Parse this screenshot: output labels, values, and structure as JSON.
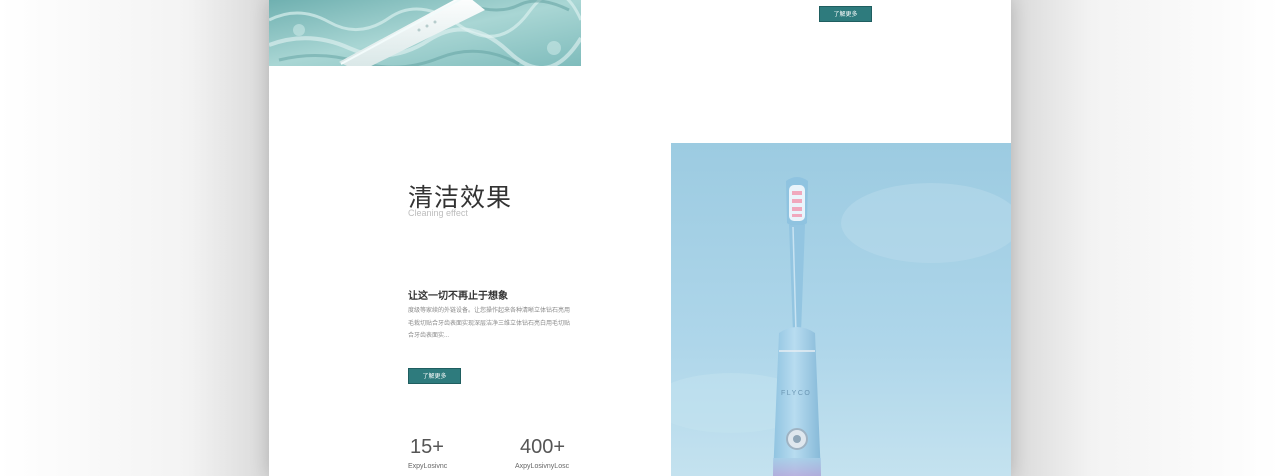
{
  "top_section": {
    "image_icon": "toothbrush-in-water-photo",
    "button_label": "了解更多"
  },
  "cleaning_section": {
    "title": "清洁效果",
    "subtitle_en": "Cleaning effect",
    "heading": "让这一切不再止于想象",
    "description": "度级等家续的外链设备。让您操作起来各种清晰立体钻石亮用毛栽切贴合牙齿表面实现深层洁净三维立体钻石亮白用毛切贴合牙齿表面实...",
    "button_label": "了解更多",
    "stats": [
      {
        "value": "15+",
        "label": "ExpyLosivnc"
      },
      {
        "value": "400+",
        "label": "AxpyLosivnyLosc"
      }
    ],
    "product_image_icon": "electric-toothbrush-photo",
    "brand_text": "FLYCO"
  },
  "colors": {
    "accent": "#2e7b7d",
    "sky_top": "#9fcce2",
    "sky_bottom": "#bfe0ee"
  }
}
